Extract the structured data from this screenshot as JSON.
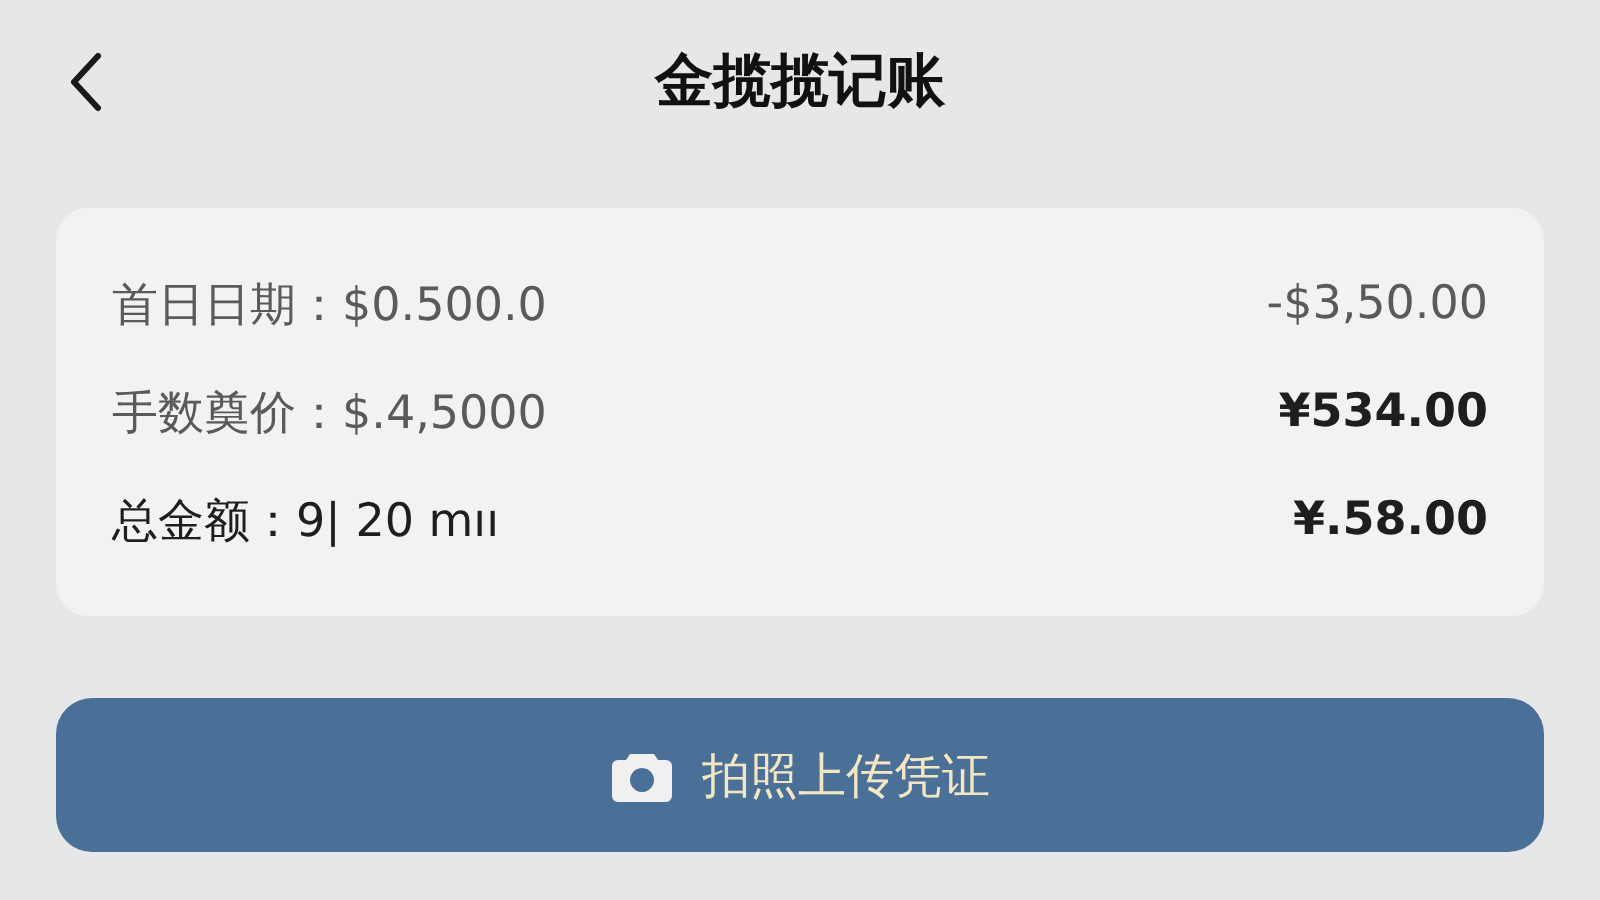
{
  "header": {
    "title": "金揽揽记账"
  },
  "summary": {
    "rows": [
      {
        "label": "首日日期：",
        "value": "$0.500.0",
        "amount": "-$3,50.00",
        "kind": "plain"
      },
      {
        "label": "手数奠价：",
        "value": "$.4,5000",
        "amount": "¥534.00",
        "kind": "bold"
      },
      {
        "label": "总金额：",
        "value": "9| 20 mıı",
        "amount": "¥.58.00",
        "kind": "total"
      }
    ]
  },
  "upload_button": {
    "label": "拍照上传凭证"
  }
}
